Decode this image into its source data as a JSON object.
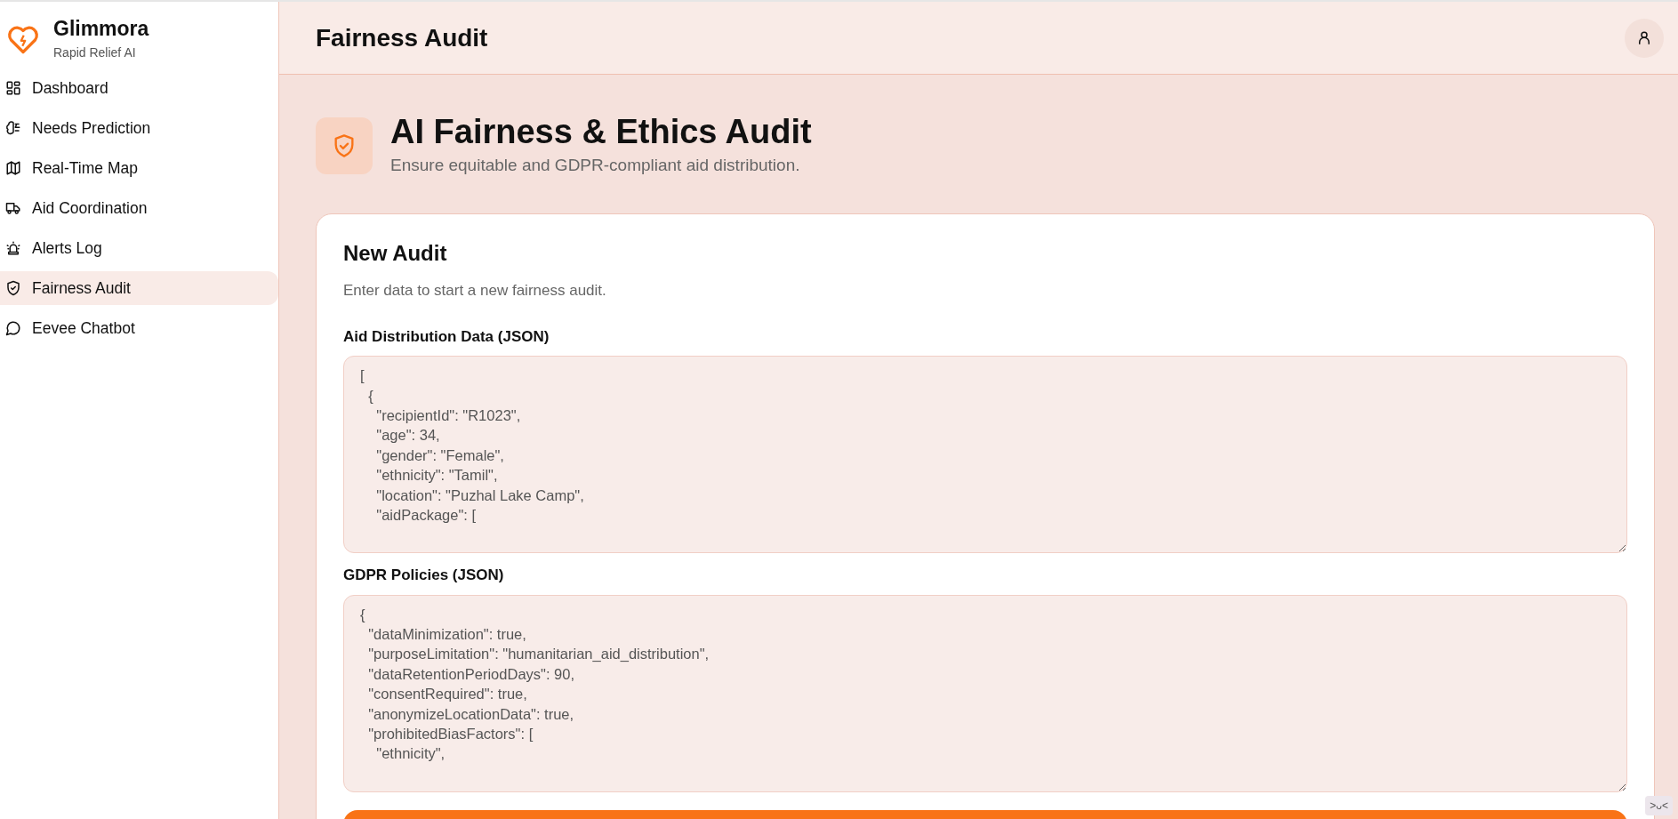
{
  "brand": {
    "name": "Glimmora",
    "tagline": "Rapid Relief AI"
  },
  "sidebar": {
    "items": [
      {
        "label": "Dashboard",
        "selected": false
      },
      {
        "label": "Needs Prediction",
        "selected": false
      },
      {
        "label": "Real-Time Map",
        "selected": false
      },
      {
        "label": "Aid Coordination",
        "selected": false
      },
      {
        "label": "Alerts Log",
        "selected": false
      },
      {
        "label": "Fairness Audit",
        "selected": true
      },
      {
        "label": "Eevee Chatbot",
        "selected": false
      }
    ]
  },
  "header": {
    "title": "Fairness Audit"
  },
  "page": {
    "title": "AI Fairness & Ethics Audit",
    "subtitle": "Ensure equitable and GDPR-compliant aid distribution."
  },
  "card": {
    "title": "New Audit",
    "description": "Enter data to start a new fairness audit.",
    "fields": [
      {
        "label": "Aid Distribution Data (JSON)",
        "value": "[\n  {\n    \"recipientId\": \"R1023\",\n    \"age\": 34,\n    \"gender\": \"Female\",\n    \"ethnicity\": \"Tamil\",\n    \"location\": \"Puzhal Lake Camp\",\n    \"aidPackage\": ["
      },
      {
        "label": "GDPR Policies (JSON)",
        "value": "{\n  \"dataMinimization\": true,\n  \"purposeLimitation\": \"humanitarian_aid_distribution\",\n  \"dataRetentionPeriodDays\": 90,\n  \"consentRequired\": true,\n  \"anonymizeLocationData\": true,\n  \"prohibitedBiasFactors\": [\n    \"ethnicity\","
      }
    ]
  },
  "floating_badge": ">ᴗ<"
}
